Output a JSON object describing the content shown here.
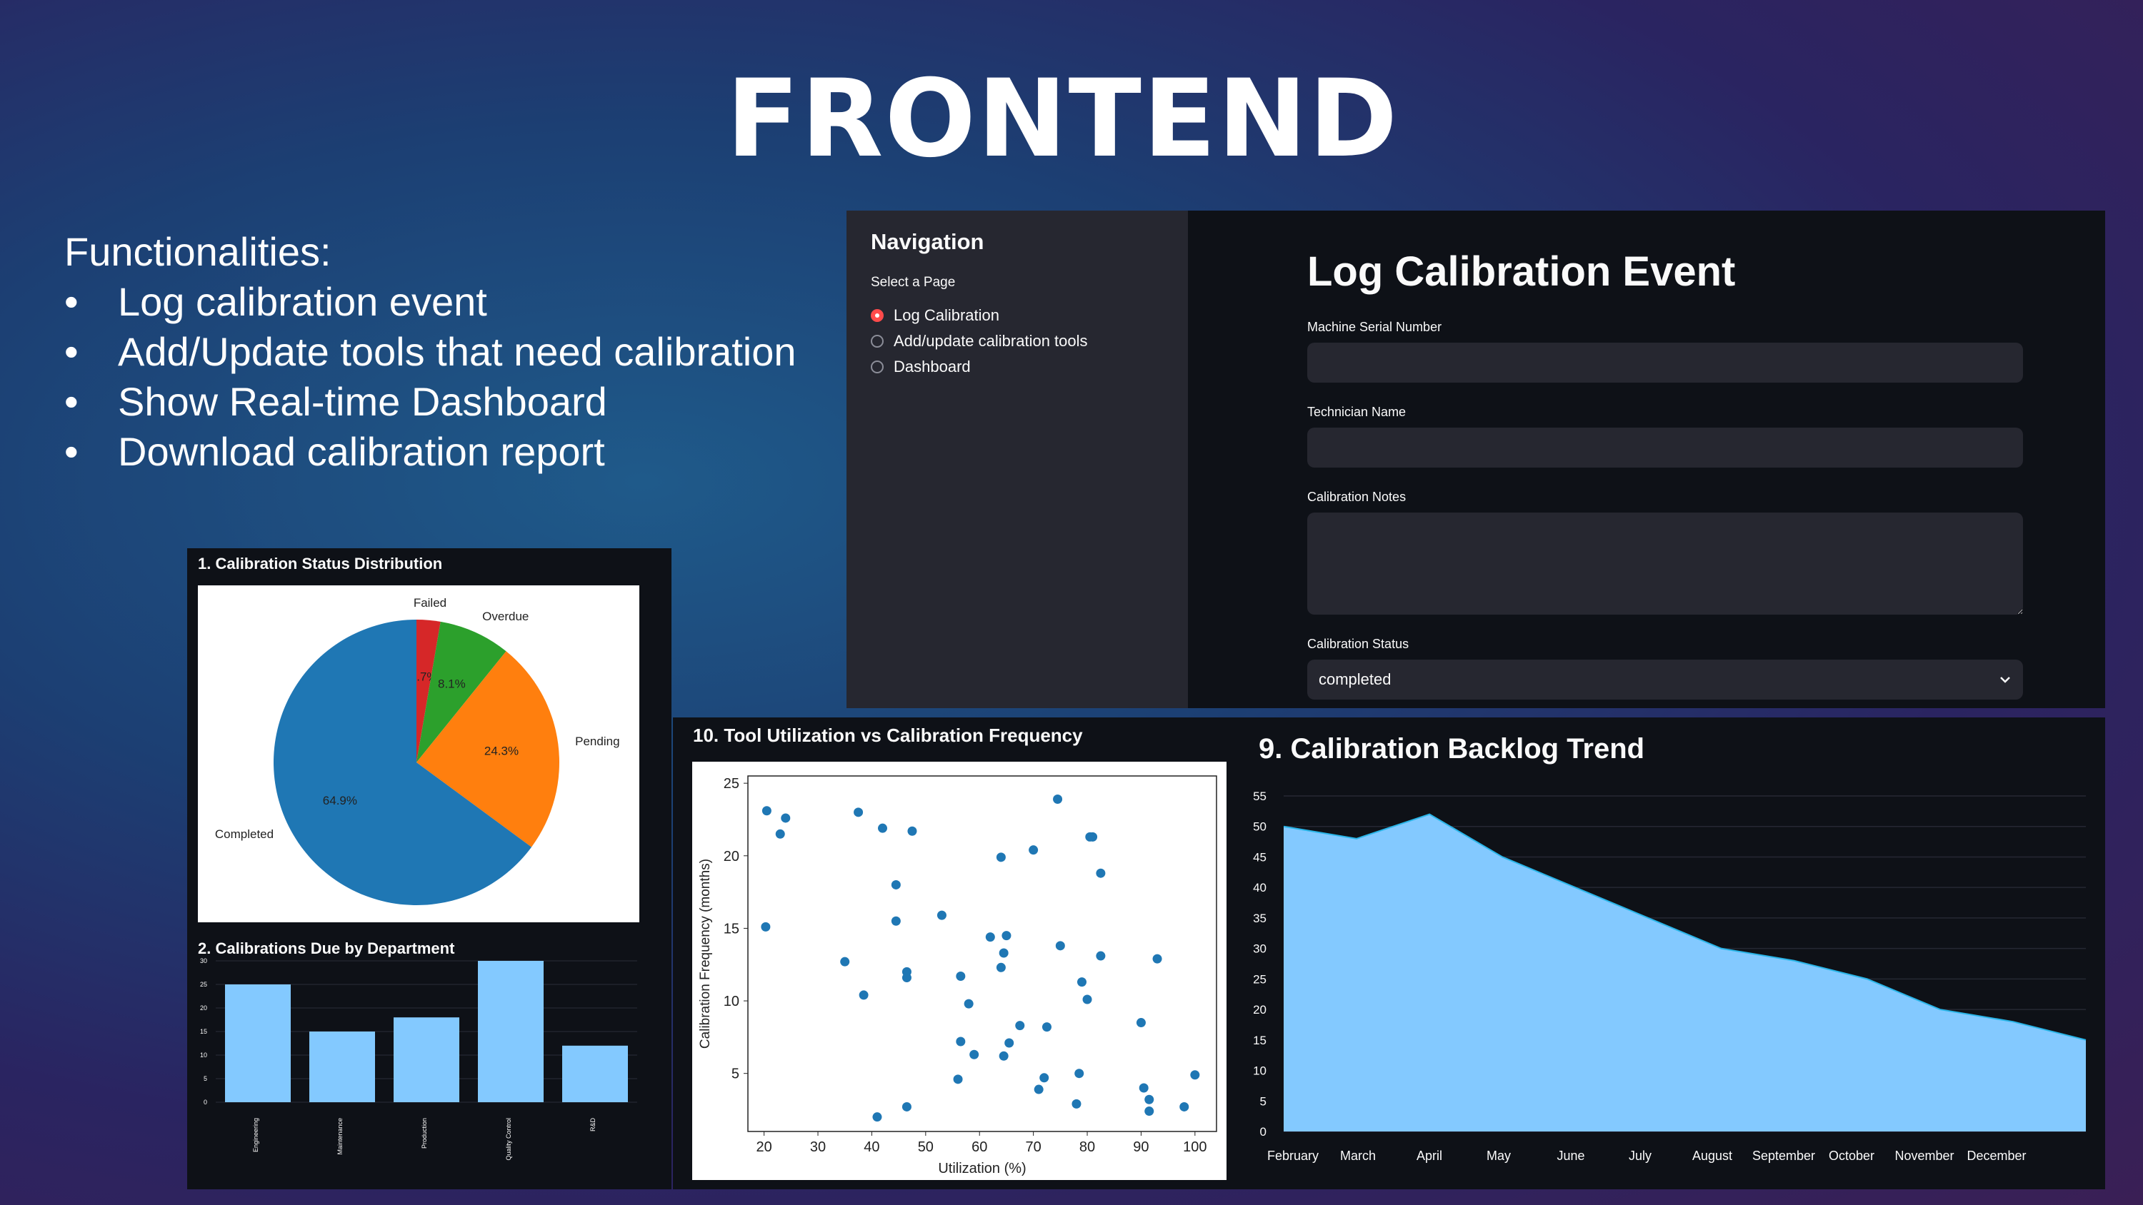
{
  "slide": {
    "title": "FRONTEND",
    "functionalities_heading": "Functionalities:",
    "functionalities": [
      "Log calibration event",
      "Add/Update tools that need calibration",
      "Show Real-time Dashboard",
      "Download calibration report"
    ]
  },
  "sidebar": {
    "title": "Navigation",
    "subtitle": "Select a Page",
    "options": [
      "Log Calibration",
      "Add/update calibration tools",
      "Dashboard"
    ],
    "selected": "Log Calibration"
  },
  "form": {
    "title": "Log Calibration Event",
    "serial_label": "Machine Serial Number",
    "serial_value": "",
    "tech_label": "Technician Name",
    "tech_value": "",
    "notes_label": "Calibration Notes",
    "notes_value": "",
    "status_label": "Calibration Status",
    "status_value": "completed"
  },
  "colors": {
    "accent": "#ff4b4b",
    "pie_blue": "#1f77b4",
    "pie_orange": "#ff7f0e",
    "pie_green": "#2ca02c",
    "pie_red": "#d62728",
    "bar": "#83c9ff"
  },
  "chart_data": [
    {
      "title": "1. Calibration Status Distribution",
      "type": "pie",
      "categories": [
        "Failed",
        "Overdue",
        "Pending",
        "Completed"
      ],
      "values": [
        2.7,
        8.1,
        24.3,
        64.9
      ],
      "labels": [
        "2.7%",
        "8.1%",
        "24.3%",
        "64.9%"
      ]
    },
    {
      "title": "2. Calibrations Due by Department",
      "type": "bar",
      "categories": [
        "Engineering",
        "Maintenance",
        "Production",
        "Quality Control",
        "R&D"
      ],
      "values": [
        25,
        15,
        18,
        30,
        12
      ],
      "ylim": [
        0,
        30
      ],
      "yticks": [
        0,
        5,
        10,
        15,
        20,
        25,
        30
      ]
    },
    {
      "title": "10. Tool Utilization vs Calibration Frequency",
      "type": "scatter",
      "xlabel": "Utilization (%)",
      "ylabel": "Calibration Frequency (months)",
      "xlim": [
        17,
        104
      ],
      "ylim": [
        1,
        25.5
      ],
      "xticks": [
        20,
        30,
        40,
        50,
        60,
        70,
        80,
        90,
        100
      ],
      "yticks": [
        5,
        10,
        15,
        20,
        25
      ],
      "points": [
        [
          20.5,
          23.1
        ],
        [
          23,
          21.5
        ],
        [
          24,
          22.6
        ],
        [
          20.3,
          15.1
        ],
        [
          35,
          12.7
        ],
        [
          37.5,
          23
        ],
        [
          38.5,
          10.4
        ],
        [
          42,
          21.9
        ],
        [
          44.5,
          18
        ],
        [
          44.5,
          15.5
        ],
        [
          46.5,
          12
        ],
        [
          46.5,
          11.6
        ],
        [
          47.5,
          21.7
        ],
        [
          46.5,
          2.7
        ],
        [
          41,
          2
        ],
        [
          53,
          15.9
        ],
        [
          56.5,
          11.7
        ],
        [
          58,
          9.8
        ],
        [
          56.5,
          7.2
        ],
        [
          56,
          4.6
        ],
        [
          59,
          6.3
        ],
        [
          62,
          14.4
        ],
        [
          64,
          12.3
        ],
        [
          64.5,
          13.3
        ],
        [
          65,
          14.5
        ],
        [
          64,
          19.9
        ],
        [
          64.5,
          6.2
        ],
        [
          65.5,
          7.1
        ],
        [
          67.5,
          8.3
        ],
        [
          70,
          20.4
        ],
        [
          71,
          3.9
        ],
        [
          72,
          4.7
        ],
        [
          72.5,
          8.2
        ],
        [
          74.5,
          23.9
        ],
        [
          75,
          13.8
        ],
        [
          78,
          2.9
        ],
        [
          78.5,
          5
        ],
        [
          79,
          11.3
        ],
        [
          80,
          10.1
        ],
        [
          80.5,
          21.3
        ],
        [
          81,
          21.3
        ],
        [
          82.5,
          18.8
        ],
        [
          82.5,
          13.1
        ],
        [
          90,
          8.5
        ],
        [
          90.5,
          4
        ],
        [
          91.5,
          3.2
        ],
        [
          91.5,
          2.4
        ],
        [
          93,
          12.9
        ],
        [
          98,
          2.7
        ],
        [
          100,
          4.9
        ]
      ]
    },
    {
      "title": "9. Calibration Backlog Trend",
      "type": "area",
      "categories": [
        "February",
        "March",
        "April",
        "May",
        "June",
        "July",
        "August",
        "September",
        "October",
        "November",
        "December"
      ],
      "values": [
        50,
        48,
        52,
        45,
        40,
        35,
        30,
        28,
        25,
        20,
        18,
        15
      ],
      "ylim": [
        0,
        55
      ],
      "yticks": [
        0,
        5,
        10,
        15,
        20,
        25,
        30,
        35,
        40,
        45,
        50,
        55
      ]
    }
  ]
}
